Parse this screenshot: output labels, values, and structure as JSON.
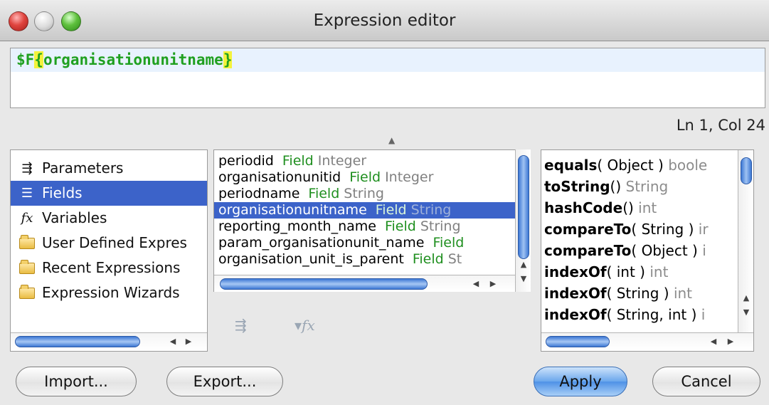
{
  "window": {
    "title": "Expression editor"
  },
  "editor": {
    "prefix": "$F",
    "open_brace": "{",
    "field": "organisationunitname",
    "close_brace": "}",
    "cursor_position": "Ln 1, Col 24"
  },
  "categories": [
    {
      "label": "Parameters",
      "icon": "parameters-icon"
    },
    {
      "label": "Fields",
      "icon": "fields-icon",
      "selected": true
    },
    {
      "label": "Variables",
      "icon": "fx-icon"
    },
    {
      "label": "User Defined Expres",
      "icon": "folder-icon"
    },
    {
      "label": "Recent Expressions",
      "icon": "folder-icon"
    },
    {
      "label": "Expression Wizards",
      "icon": "folder-icon"
    }
  ],
  "fields": [
    {
      "name": "periodid",
      "kind": "Field",
      "type": "Integer"
    },
    {
      "name": "organisationunitid",
      "kind": "Field",
      "type": "Integer"
    },
    {
      "name": "periodname",
      "kind": "Field",
      "type": "String"
    },
    {
      "name": "organisationunitname",
      "kind": "Field",
      "type": "String",
      "selected": true
    },
    {
      "name": "reporting_month_name",
      "kind": "Field",
      "type": "String"
    },
    {
      "name": "param_organisationunit_name",
      "kind": "Field",
      "type": ""
    },
    {
      "name": "organisation_unit_is_parent",
      "kind": "Field",
      "type": "St"
    }
  ],
  "methods": [
    {
      "name": "equals",
      "args": "( Object )",
      "ret": "boole"
    },
    {
      "name": "toString",
      "args": "()",
      "ret": "String"
    },
    {
      "name": "hashCode",
      "args": "()",
      "ret": "int"
    },
    {
      "name": "compareTo",
      "args": "( String )",
      "ret": "ir"
    },
    {
      "name": "compareTo",
      "args": "( Object )",
      "ret": "i"
    },
    {
      "name": "indexOf",
      "args": "( int )",
      "ret": "int"
    },
    {
      "name": "indexOf",
      "args": "( String )",
      "ret": "int"
    },
    {
      "name": "indexOf",
      "args": "( String, int )",
      "ret": "i"
    }
  ],
  "buttons": {
    "import": "Import...",
    "export": "Export...",
    "apply": "Apply",
    "cancel": "Cancel"
  },
  "colors": {
    "selection": "#3c63c9",
    "field_kind": "#1f8f1f",
    "code": "#20a020",
    "brace_highlight": "#f4f23c"
  }
}
